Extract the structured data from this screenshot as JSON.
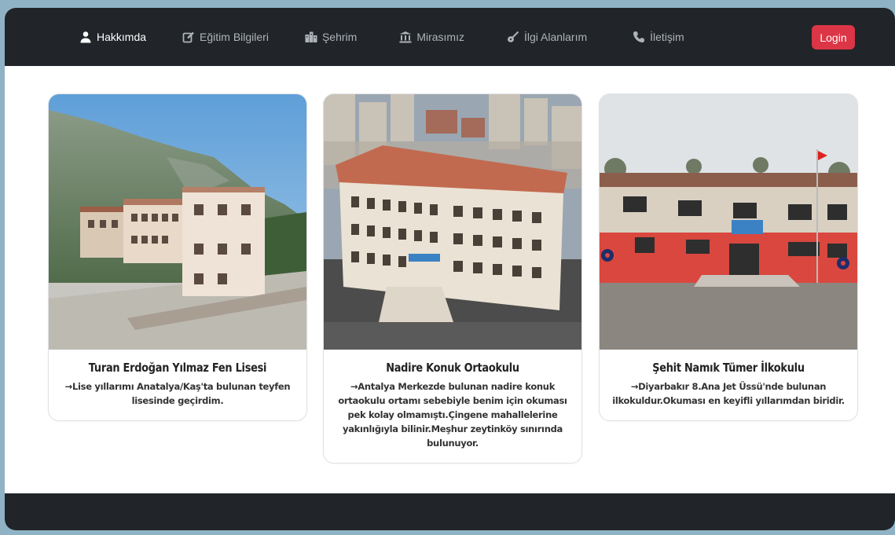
{
  "nav": {
    "items": [
      {
        "label": "Hakkımda",
        "icon": "user-icon"
      },
      {
        "label": "Eğitim Bilgileri",
        "icon": "edit-icon"
      },
      {
        "label": "Şehrim",
        "icon": "city-icon"
      },
      {
        "label": "Mirasımız",
        "icon": "landmark-icon"
      },
      {
        "label": "İlgi Alanlarım",
        "icon": "guitar-icon"
      },
      {
        "label": "İletişim",
        "icon": "phone-icon"
      }
    ],
    "login_label": "Login"
  },
  "cards": [
    {
      "title": "Turan Erdoğan Yılmaz Fen Lisesi",
      "text": "→Lise yıllarımı Anatalya/Kaş'ta bulunan teyfen lisesinde geçirdim.",
      "image": "school-building-mountains-photo"
    },
    {
      "title": "Nadire Konuk Ortaokulu",
      "text": "→Antalya Merkezde bulunan nadire konuk ortaokulu ortamı sebebiyle benim için okuması pek kolay olmamıştı.Çingene mahallelerine yakınlığıyla bilinir.Meşhur zeytinköy sınırında bulunuyor.",
      "image": "school-building-city-photo"
    },
    {
      "title": "Şehit Namık Tümer İlkokulu",
      "text": "→Diyarbakır 8.Ana Jet Üssü'nde bulunan ilkokuldur.Okuması en keyifli yıllarımdan biridir.",
      "image": "school-building-courtyard-photo"
    }
  ],
  "colors": {
    "navbar": "#212529",
    "login": "#dc3545",
    "backdrop": "#8fb3c4"
  }
}
